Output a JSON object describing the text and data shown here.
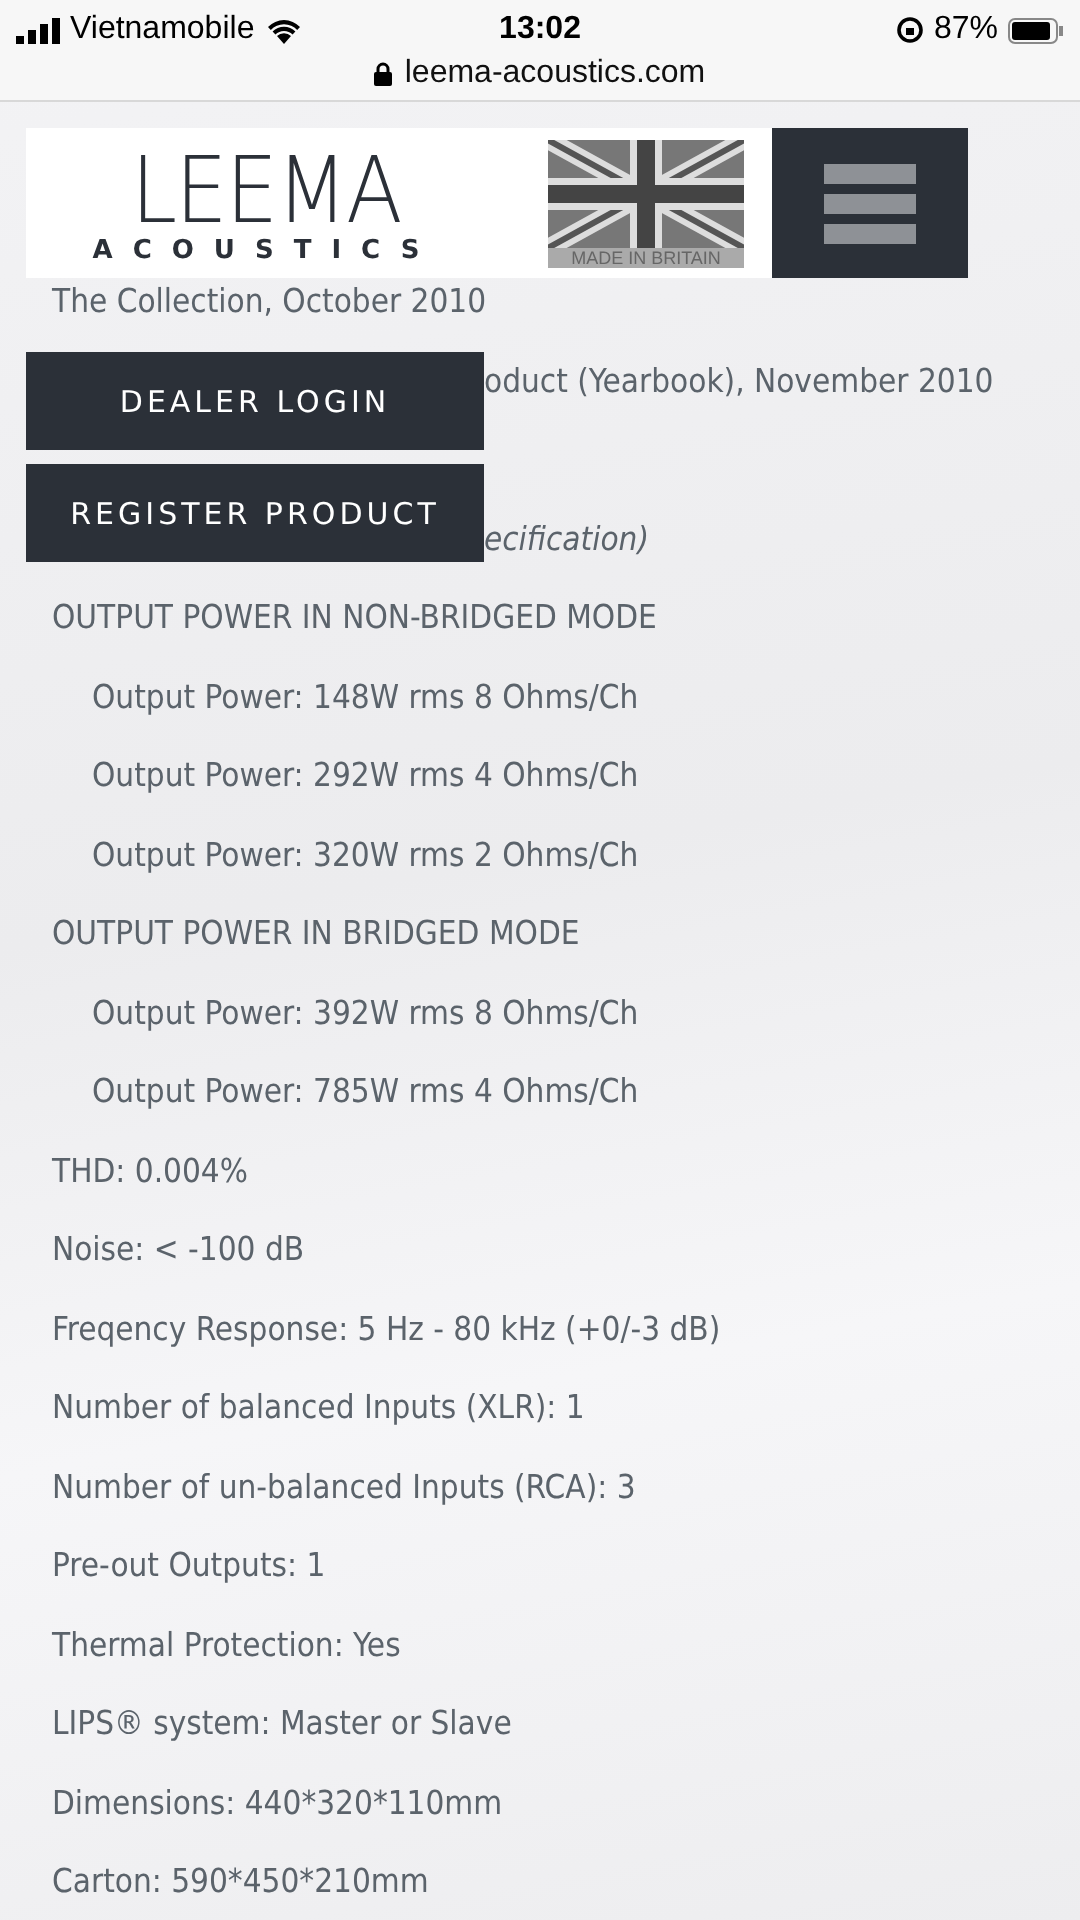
{
  "status_bar": {
    "carrier": "Vietnamobile",
    "time": "13:02",
    "battery": "87%"
  },
  "address_bar": {
    "url": "leema-acoustics.com"
  },
  "header": {
    "logo_title": "LEEMA",
    "logo_subtitle": "ACOUSTICS",
    "flag_caption": "MADE IN BRITAIN"
  },
  "nav_buttons": [
    "DEALER LOGIN",
    "REGISTER PRODUCT"
  ],
  "top_lines": [
    {
      "kind": "full",
      "text": "The Collection, October 2010"
    },
    {
      "kind": "clipped",
      "text": "oduct (Yearbook), November 2010"
    },
    {
      "kind": "clipped-italic",
      "text": "ecification)"
    }
  ],
  "spec_groups": [
    {
      "heading": "OUTPUT POWER IN NON-BRIDGED MODE",
      "children": [
        "Output Power: 148W rms 8 Ohms/Ch",
        "Output Power: 292W rms 4 Ohms/Ch",
        "Output Power: 320W rms 2 Ohms/Ch"
      ]
    },
    {
      "heading": "OUTPUT POWER IN BRIDGED MODE",
      "children": [
        "Output Power: 392W rms 8 Ohms/Ch",
        "Output Power: 785W rms 4 Ohms/Ch"
      ]
    },
    {
      "heading": "THD: 0.004%"
    },
    {
      "heading": "Noise: < -100 dB"
    },
    {
      "heading": "Freqency Response: 5 Hz - 80 kHz (+0/-3 dB)"
    },
    {
      "heading": "Number of balanced Inputs (XLR): 1"
    },
    {
      "heading": "Number of un-balanced Inputs (RCA): 3"
    },
    {
      "heading": "Pre-out Outputs: 1"
    },
    {
      "heading": "Thermal Protection: Yes"
    },
    {
      "heading": "LIPS® system: Master or Slave"
    },
    {
      "heading": "Dimensions: 440*320*110mm"
    },
    {
      "heading": "Carton: 590*450*210mm"
    }
  ]
}
